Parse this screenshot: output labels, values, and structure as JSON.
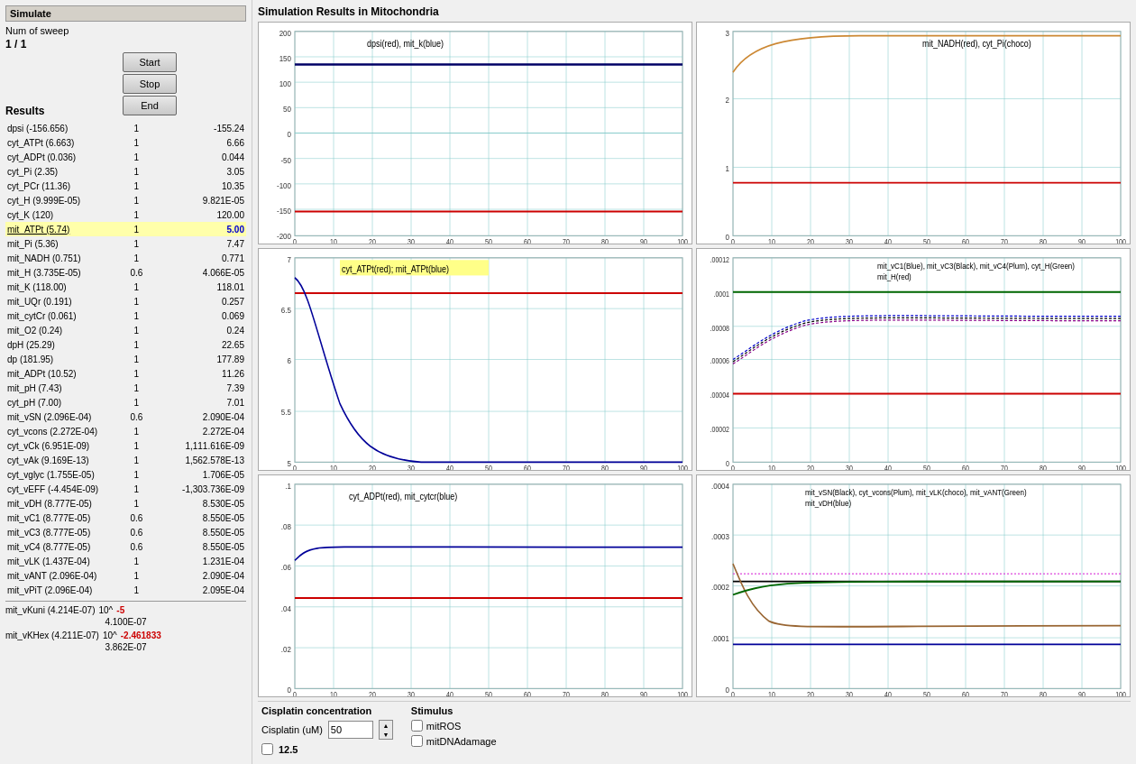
{
  "left": {
    "simulate_title": "Simulate",
    "num_sweep_label": "Num of sweep",
    "sweep_current": "1",
    "sweep_total": "1",
    "btn_start": "Start",
    "btn_stop": "Stop",
    "btn_end": "End",
    "results_title": "Results",
    "rows": [
      {
        "name": "dpsi (-156.656)",
        "sweep": "1",
        "value": "-155.24",
        "highlight": false
      },
      {
        "name": "cyt_ATPt (6.663)",
        "sweep": "1",
        "value": "6.66",
        "highlight": false
      },
      {
        "name": "cyt_ADPt (0.036)",
        "sweep": "1",
        "value": "0.044",
        "highlight": false
      },
      {
        "name": "cyt_Pi (2.35)",
        "sweep": "1",
        "value": "3.05",
        "highlight": false
      },
      {
        "name": "cyt_PCr (11.36)",
        "sweep": "1",
        "value": "10.35",
        "highlight": false
      },
      {
        "name": "cyt_H (9.999E-05)",
        "sweep": "1",
        "value": "9.821E-05",
        "highlight": false
      },
      {
        "name": "cyt_K (120)",
        "sweep": "1",
        "value": "120.00",
        "highlight": false
      },
      {
        "name": "mit_ATPt (5.74)",
        "sweep": "1",
        "value": "5.00",
        "highlight": true
      },
      {
        "name": "mit_Pi (5.36)",
        "sweep": "1",
        "value": "7.47",
        "highlight": false
      },
      {
        "name": "mit_NADH (0.751)",
        "sweep": "1",
        "value": "0.771",
        "highlight": false
      },
      {
        "name": "mit_H (3.735E-05)",
        "sweep": "0.6",
        "value": "4.066E-05",
        "highlight": false
      },
      {
        "name": "mit_K (118.00)",
        "sweep": "1",
        "value": "118.01",
        "highlight": false
      },
      {
        "name": "mit_UQr (0.191)",
        "sweep": "1",
        "value": "0.257",
        "highlight": false
      },
      {
        "name": "mit_cytCr (0.061)",
        "sweep": "1",
        "value": "0.069",
        "highlight": false
      },
      {
        "name": "mit_O2 (0.24)",
        "sweep": "1",
        "value": "0.24",
        "highlight": false
      },
      {
        "name": "dpH (25.29)",
        "sweep": "1",
        "value": "22.65",
        "highlight": false
      },
      {
        "name": "dp (181.95)",
        "sweep": "1",
        "value": "177.89",
        "highlight": false
      },
      {
        "name": "mit_ADPt (10.52)",
        "sweep": "1",
        "value": "11.26",
        "highlight": false
      },
      {
        "name": "mit_pH (7.43)",
        "sweep": "1",
        "value": "7.39",
        "highlight": false
      },
      {
        "name": "cyt_pH (7.00)",
        "sweep": "1",
        "value": "7.01",
        "highlight": false
      },
      {
        "name": "mit_vSN (2.096E-04)",
        "sweep": "0.6",
        "value": "2.090E-04",
        "highlight": false
      },
      {
        "name": "cyt_vcons (2.272E-04)",
        "sweep": "1",
        "value": "2.272E-04",
        "highlight": false
      },
      {
        "name": "cyt_vCk (6.951E-09)",
        "sweep": "1",
        "value": "1,111.616E-09",
        "highlight": false
      },
      {
        "name": "cyt_vAk (9.169E-13)",
        "sweep": "1",
        "value": "1,562.578E-13",
        "highlight": false
      },
      {
        "name": "cyt_vglyc (1.755E-05)",
        "sweep": "1",
        "value": "1.706E-05",
        "highlight": false
      },
      {
        "name": "cyt_vEFF (-4.454E-09)",
        "sweep": "1",
        "value": "-1,303.736E-09",
        "highlight": false
      },
      {
        "name": "mit_vDH (8.777E-05)",
        "sweep": "1",
        "value": "8.530E-05",
        "highlight": false
      },
      {
        "name": "mit_vC1 (8.777E-05)",
        "sweep": "0.6",
        "value": "8.550E-05",
        "highlight": false
      },
      {
        "name": "mit_vC3 (8.777E-05)",
        "sweep": "0.6",
        "value": "8.550E-05",
        "highlight": false
      },
      {
        "name": "mit_vC4 (8.777E-05)",
        "sweep": "0.6",
        "value": "8.550E-05",
        "highlight": false
      },
      {
        "name": "mit_vLK (1.437E-04)",
        "sweep": "1",
        "value": "1.231E-04",
        "highlight": false
      },
      {
        "name": "mit_vANT (2.096E-04)",
        "sweep": "1",
        "value": "2.090E-04",
        "highlight": false
      },
      {
        "name": "mit_vPiT (2.096E-04)",
        "sweep": "1",
        "value": "2.095E-04",
        "highlight": false
      }
    ],
    "kuni_label": "mit_vKuni (4.214E-07)",
    "kuni_exp": "10^",
    "kuni_exp_val": "-5",
    "kuni_calc": "4.100E-07",
    "khex_label": "mit_vKHex (4.211E-07)",
    "khex_exp": "10^",
    "khex_exp_val": "-2.461833",
    "khex_calc": "3.862E-07"
  },
  "right": {
    "title": "Simulation Results in Mitochondria",
    "charts": [
      {
        "id": "chart1",
        "title": "dpsi(red), mit_k(blue)",
        "title_highlight": false,
        "ymin": -200,
        "ymax": 200,
        "yticks": [
          "-200",
          "-150",
          "-100",
          "-50",
          "0",
          "50",
          "100",
          "150",
          "200"
        ],
        "xticks": [
          "0",
          "10",
          "20",
          "30",
          "40",
          "50",
          "60",
          "70",
          "80",
          "90",
          "100"
        ],
        "lines": [
          {
            "color": "#cc0000",
            "d": "flat_low",
            "value": -155
          },
          {
            "color": "#000066",
            "d": "flat_high",
            "value": 135
          }
        ]
      },
      {
        "id": "chart2",
        "title": "mit_NADH(red), cyt_Pi(choco)",
        "title_highlight": false,
        "ymin": 0,
        "ymax": 3,
        "yticks": [
          "0",
          "1",
          "2",
          "3"
        ],
        "xticks": [
          "0",
          "10",
          "20",
          "30",
          "40",
          "50",
          "60",
          "70",
          "80",
          "90",
          "100"
        ],
        "lines": [
          {
            "color": "#cc0000",
            "d": "flat_vlow"
          },
          {
            "color": "#996633",
            "d": "rise_then_flat"
          }
        ]
      },
      {
        "id": "chart3",
        "title_part1": "cyt_ATPt(red);",
        "title_part2": "mit_ATPt(blue)",
        "title_highlight": true,
        "ymin": 5,
        "ymax": 7,
        "yticks": [
          "5",
          "5.5",
          "6",
          "6.5",
          "7"
        ],
        "xticks": [
          "0",
          "10",
          "20",
          "30",
          "40",
          "50",
          "60",
          "70",
          "80",
          "90",
          "100"
        ],
        "lines": [
          {
            "color": "#cc0000",
            "d": "flat_top"
          },
          {
            "color": "#000099",
            "d": "decay_curve"
          }
        ]
      },
      {
        "id": "chart4",
        "title": "mit_vC1(Blue), mit_vC3(Black), mit_vC4(Plum), cyt_H(Green)\nmit_H(red)",
        "title_highlight": false,
        "ymin": 0,
        "ymax": 0.00012,
        "yticks": [
          "0",
          "0.00002",
          "0.00004",
          "0.00006",
          "0.00008",
          "0.0001",
          "0.00012"
        ],
        "xticks": [
          "0",
          "10",
          "20",
          "30",
          "40",
          "50",
          "60",
          "70",
          "80",
          "90",
          "100"
        ],
        "lines": [
          {
            "color": "#0000cc",
            "d": "flat_low_vc"
          },
          {
            "color": "#000000",
            "d": "flat_low_vc"
          },
          {
            "color": "#880088",
            "d": "flat_low_vc"
          },
          {
            "color": "#006600",
            "d": "flat_high_cH"
          },
          {
            "color": "#cc0000",
            "d": "flat_mid_H"
          }
        ]
      },
      {
        "id": "chart5",
        "title": "cyt_ADPt(red), mit_cytcr(blue)",
        "title_highlight": false,
        "ymin": 0,
        "ymax": 0.1,
        "yticks": [
          "0",
          ".02",
          ".04",
          ".06",
          ".08",
          ".1"
        ],
        "xticks": [
          "0",
          "10",
          "20",
          "30",
          "40",
          "50",
          "60",
          "70",
          "80",
          "90",
          "100"
        ],
        "lines": [
          {
            "color": "#cc0000",
            "d": "flat_low_adp"
          },
          {
            "color": "#000099",
            "d": "rise_then_flat_cytcr"
          }
        ]
      },
      {
        "id": "chart6",
        "title": "mit_vSN(Black), cyt_vcons(Plum), mit_vLK(choco), mit_vANT(Green)\nmit_vDH(blue)",
        "title_highlight": false,
        "ymin": 0,
        "ymax": 0.0004,
        "yticks": [
          "0",
          "0.0001",
          "0.0002",
          "0.0003",
          "0.0004"
        ],
        "xticks": [
          "0",
          "10",
          "20",
          "30",
          "40",
          "50",
          "60",
          "70",
          "80",
          "90",
          "100"
        ],
        "lines": [
          {
            "color": "#000000",
            "d": "flat_vsn"
          },
          {
            "color": "#880088",
            "d": "flat_plum"
          },
          {
            "color": "#996633",
            "d": "flat_choco"
          },
          {
            "color": "#006600",
            "d": "rise_green"
          },
          {
            "color": "#000099",
            "d": "flat_blue_vdh"
          }
        ]
      }
    ],
    "cisplatin": {
      "title": "Cisplatin concentration",
      "label": "Cisplatin (uM)",
      "value": "50",
      "calc": "12.5"
    },
    "stimulus": {
      "title": "Stimulus",
      "mitROS": "mitROS",
      "mitDNAdamage": "mitDNAdamage"
    }
  }
}
